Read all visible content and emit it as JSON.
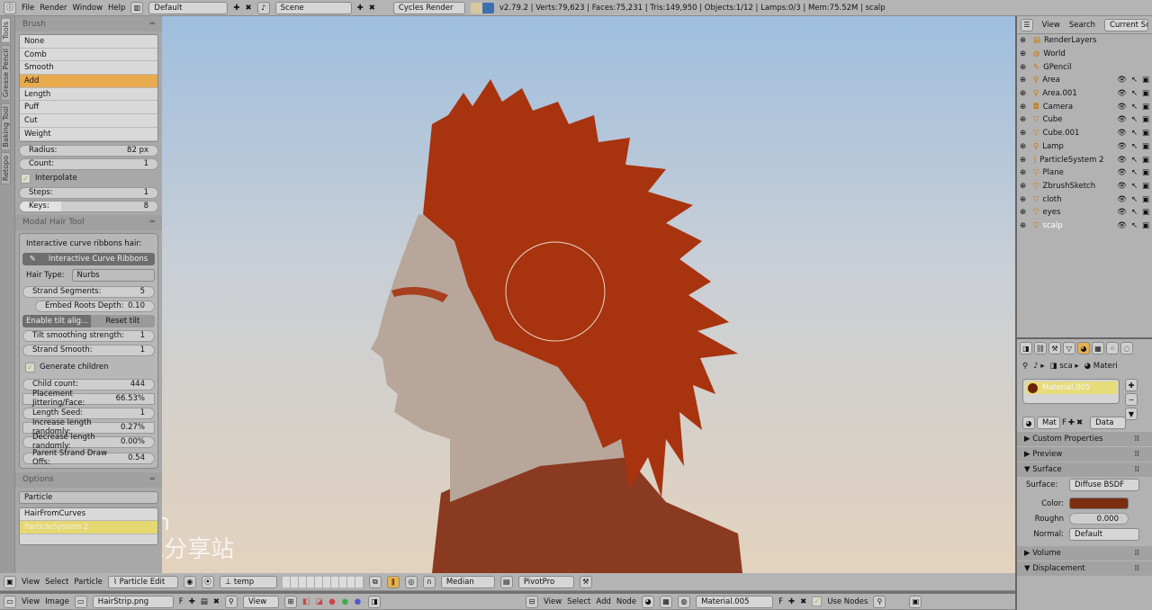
{
  "topbar": {
    "menus": [
      "File",
      "Render",
      "Window",
      "Help"
    ],
    "layout": "Default",
    "scene": "Scene",
    "engine": "Cycles Render",
    "stats": "v2.79.2 | Verts:79,623 | Faces:75,231 | Tris:149,950 | Objects:1/12 | Lamps:0/3 | Mem:75.52M | scalp"
  },
  "tool_tabs": [
    "Tools",
    "Grease Pencil",
    "Baking Tool",
    "Retopo"
  ],
  "brush": {
    "title": "Brush",
    "items": [
      "None",
      "Comb",
      "Smooth",
      "Add",
      "Length",
      "Puff",
      "Cut",
      "Weight"
    ],
    "selected": "Add",
    "radius_label": "Radius:",
    "radius": "82 px",
    "count_label": "Count:",
    "count": "1",
    "interpolate": "Interpolate",
    "steps_label": "Steps:",
    "steps": "1",
    "keys_label": "Keys:",
    "keys": "8"
  },
  "modal": {
    "title": "Modal Hair Tool",
    "desc": "Interactive curve ribbons hair:",
    "button": "Interactive Curve Ribbons",
    "hair_type_label": "Hair Type:",
    "hair_type": "Nurbs",
    "rows1": [
      {
        "label": "Strand Segments:",
        "value": "5"
      },
      {
        "label": "Embed Roots Depth:",
        "value": "0.10"
      }
    ],
    "enable_tilt": "Enable tilt alig...",
    "reset_tilt": "Reset tilt",
    "rows2": [
      {
        "label": "Tilt smoothing strength:",
        "value": "1"
      },
      {
        "label": "Strand Smooth:",
        "value": "1"
      }
    ],
    "generate_children": "Generate children",
    "rows3": [
      {
        "label": "Child count:",
        "value": "444"
      },
      {
        "label": "Placement Jittering/Face:",
        "value": "66.53%"
      },
      {
        "label": "Length Seed:",
        "value": "1"
      },
      {
        "label": "Increase length randomly:",
        "value": "0.27%"
      },
      {
        "label": "Decrease length randomly:",
        "value": "0.00%"
      }
    ],
    "parent_offset_label": "Parent Strand Draw Offs:",
    "parent_offset": "0.54"
  },
  "options": {
    "title": "Options",
    "mode": "Particle",
    "list": [
      "HairFromCurves",
      "ParticleSystem 2"
    ]
  },
  "watermark": {
    "line1": "iiidea.cn",
    "line2": "专业CG资源分享站"
  },
  "view3d_header": {
    "menus": [
      "View",
      "Select",
      "Particle"
    ],
    "mode": "Particle Edit",
    "orientation": "temp",
    "pivot": "Median",
    "pivotpro": "PivotPro"
  },
  "image_header": {
    "menus": [
      "View",
      "Image"
    ],
    "image": "HairStrip.png",
    "f": "F",
    "view": "View"
  },
  "node_header": {
    "menus": [
      "View",
      "Select",
      "Add",
      "Node"
    ],
    "material": "Material.005",
    "f": "F",
    "use_nodes": "Use Nodes"
  },
  "outliner": {
    "menus": [
      "View",
      "Search"
    ],
    "display": "Current Scene",
    "items": [
      "RenderLayers",
      "World",
      "GPencil",
      "Area",
      "Area.001",
      "Camera",
      "Cube",
      "Cube.001",
      "Lamp",
      "ParticleSystem 2",
      "Plane",
      "ZbrushSketch",
      "cloth",
      "eyes",
      "scalp"
    ],
    "active": "scalp"
  },
  "properties": {
    "crumb1": "sca",
    "crumb2": "Materi",
    "material_slot": "Material.005",
    "mat_name": "Mat",
    "f": "F",
    "link": "Data",
    "sections": [
      "Custom Properties",
      "Preview",
      "Surface"
    ],
    "surface_label": "Surface:",
    "surface": "Diffuse BSDF",
    "color_label": "Color:",
    "color": "#7a2e10",
    "rough_label": "Roughn",
    "rough": "0.000",
    "normal_label": "Normal:",
    "normal": "Default",
    "sections2": [
      "Volume",
      "Displacement"
    ]
  },
  "colors": {
    "selected": "#e8aa4e",
    "hair": "#a8330f",
    "skin": "#b8a59a"
  }
}
